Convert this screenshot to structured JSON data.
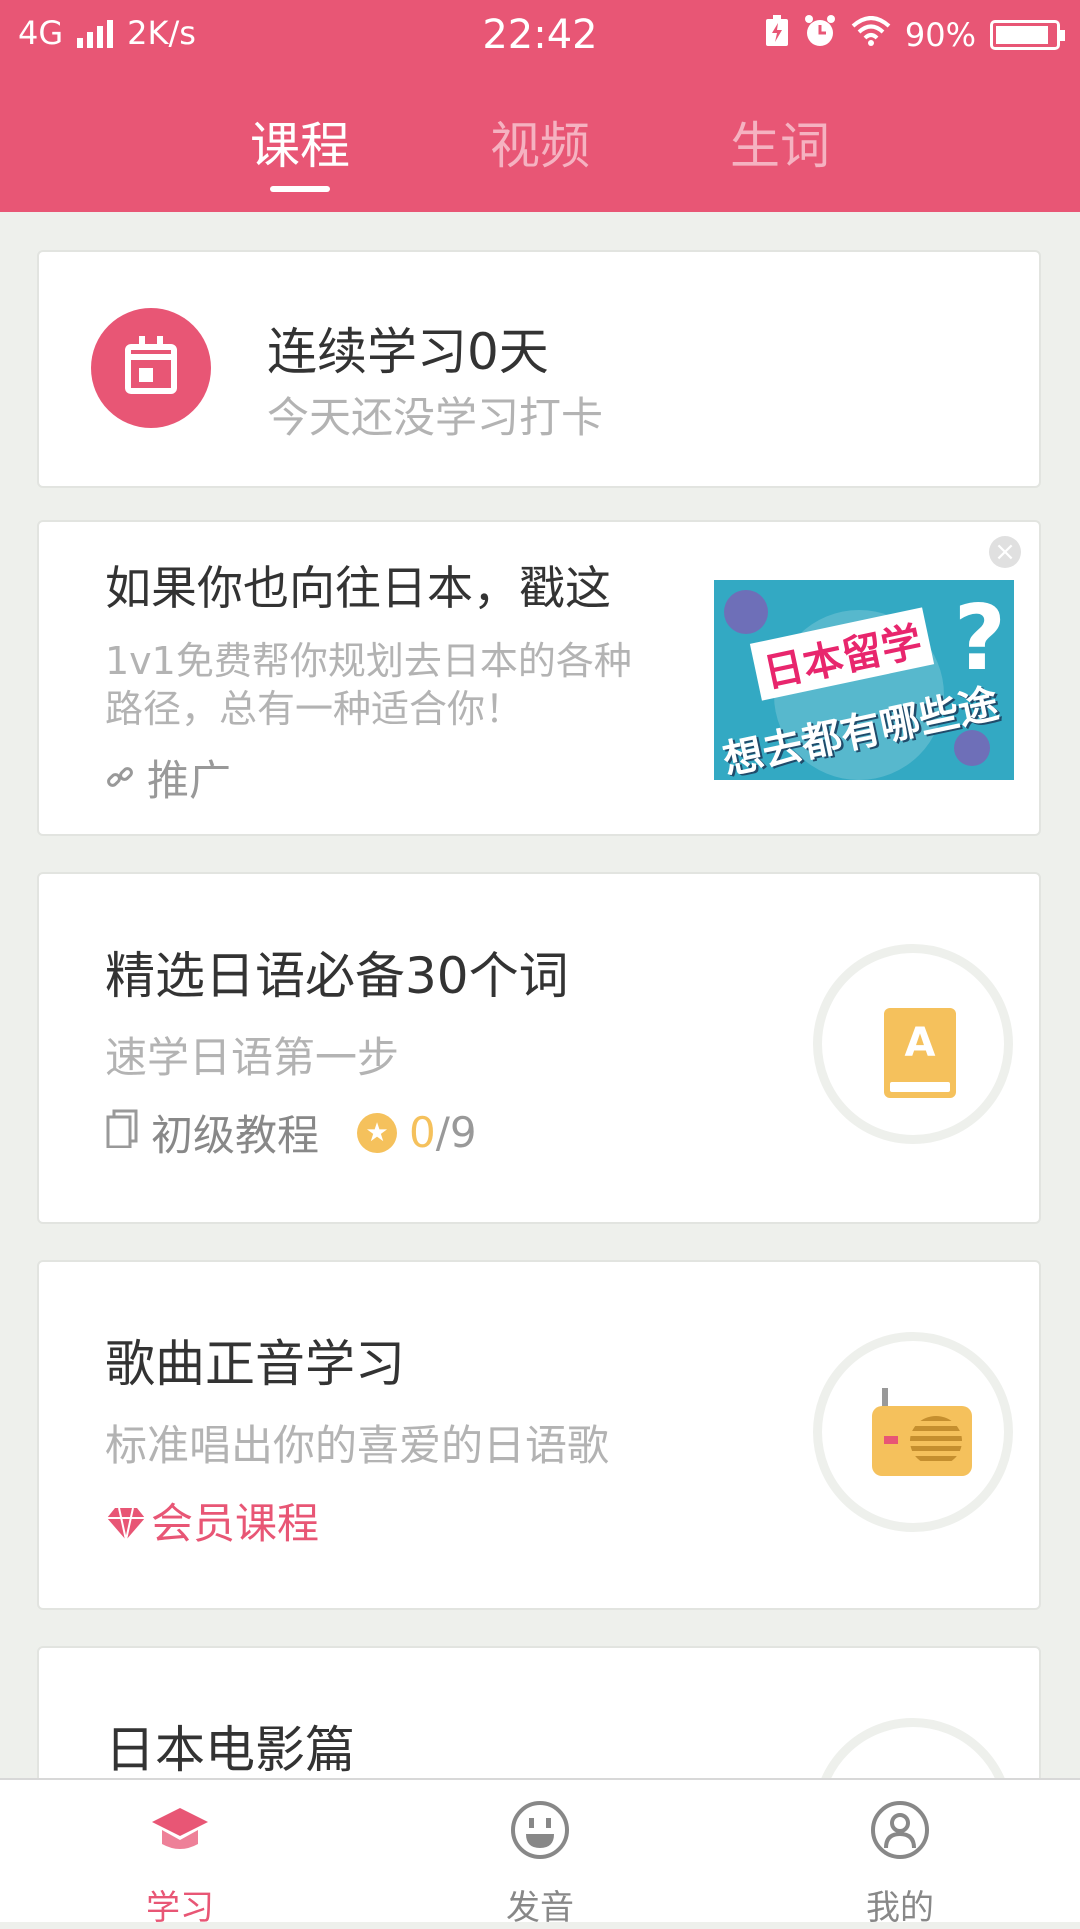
{
  "status_bar": {
    "network": "4G",
    "speed": "2K/s",
    "time": "22:42",
    "battery": "90%"
  },
  "top_tabs": [
    {
      "label": "课程",
      "active": true
    },
    {
      "label": "视频",
      "active": false
    },
    {
      "label": "生词",
      "active": false
    }
  ],
  "streak": {
    "title": "连续学习0天",
    "subtitle": "今天还没学习打卡",
    "icon": "calendar-icon"
  },
  "ad": {
    "title": "如果你也向往日本，戳这",
    "desc_line1": "1v1免费帮你规划去日本的各种",
    "desc_line2": "路径，总有一种适合你！",
    "tag": "推广",
    "image_line1": "日本留学",
    "image_line2": "想去都有哪些途径",
    "image_mark": "?"
  },
  "courses": [
    {
      "title": "精选日语必备30个词",
      "subtitle": "速学日语第一步",
      "level": "初级教程",
      "progress_done": "0",
      "progress_total": "/9",
      "icon": "book-icon",
      "icon_letter": "A"
    },
    {
      "title": "歌曲正音学习",
      "subtitle": "标准唱出你的喜爱的日语歌",
      "member_label": "会员课程",
      "icon": "radio-icon"
    },
    {
      "title": "日本电影篇"
    }
  ],
  "bottom_nav": [
    {
      "label": "学习",
      "icon": "graduation-cap-icon",
      "active": true
    },
    {
      "label": "发音",
      "icon": "smiley-icon",
      "active": false
    },
    {
      "label": "我的",
      "icon": "user-icon",
      "active": false
    }
  ],
  "colors": {
    "brand": "#e85675",
    "accent_yellow": "#f5c15c",
    "background": "#eef0ec"
  }
}
